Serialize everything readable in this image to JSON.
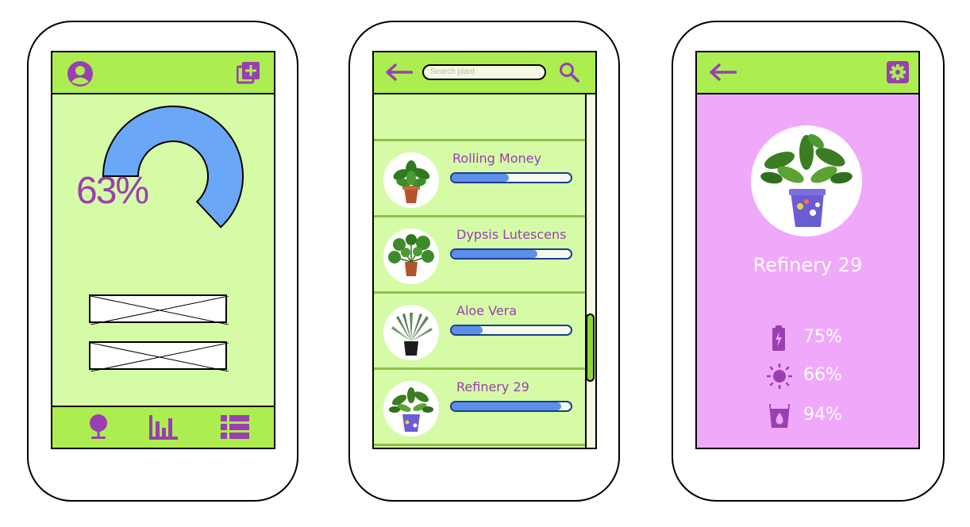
{
  "dashboard": {
    "overall_percent": "63%",
    "progress": 0.63,
    "nav": [
      "plant-icon",
      "bar-chart-icon",
      "list-icon"
    ]
  },
  "plant_list": {
    "search_placeholder": "Search plant",
    "plants": [
      {
        "name": "Rolling Money",
        "level": 0.48
      },
      {
        "name": "Dypsis Lutescens",
        "level": 0.72
      },
      {
        "name": "Aloe Vera",
        "level": 0.26
      },
      {
        "name": "Refinery 29",
        "level": 0.92
      }
    ]
  },
  "plant_detail": {
    "name": "Refinery 29",
    "battery": "75%",
    "light": "66%",
    "water": "94%"
  },
  "colors": {
    "bar_green": "#acee4f",
    "screen_green": "#d5fba6",
    "accent_purple": "#9a3fb1",
    "detail_pink": "#f0a8fb",
    "progress_blue": "#5b8fe8"
  }
}
